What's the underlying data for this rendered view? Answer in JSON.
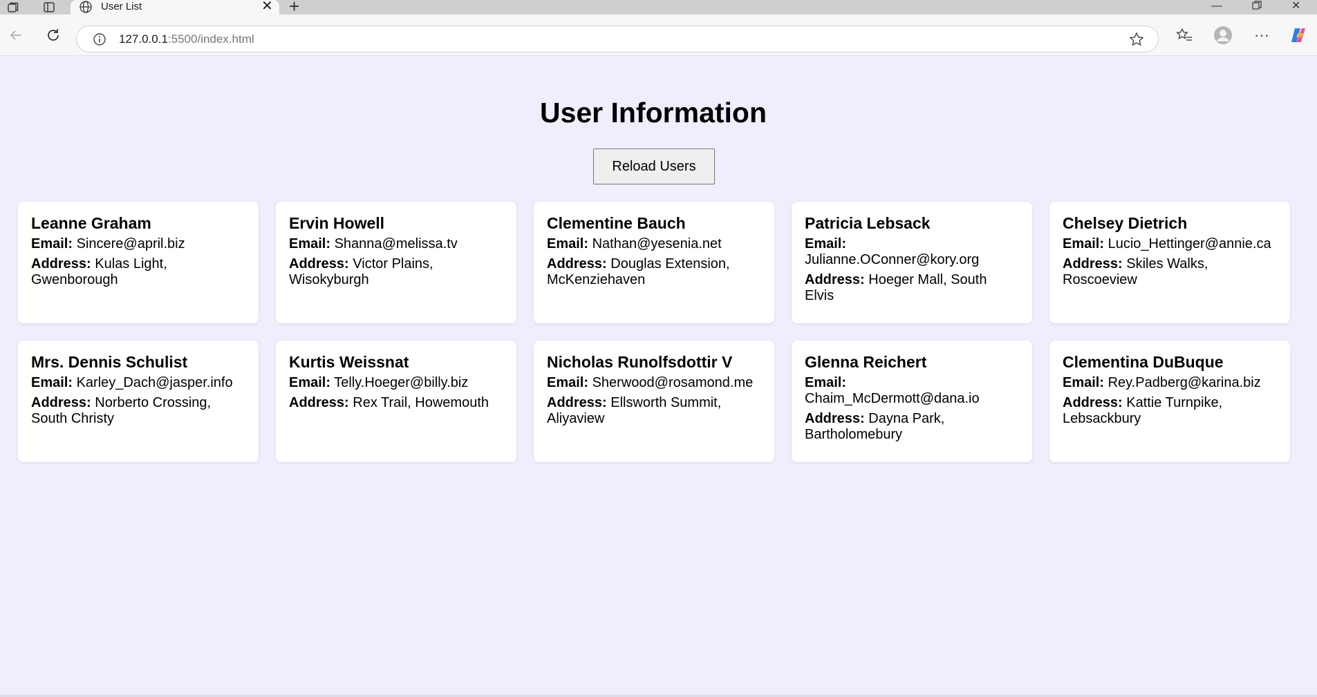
{
  "browser": {
    "tab_title": "User List",
    "url_host": "127.0.0.1",
    "url_rest": ":5500/index.html"
  },
  "page": {
    "heading": "User Information",
    "reload_label": "Reload Users",
    "email_label": "Email:",
    "address_label": "Address:"
  },
  "users": [
    {
      "name": "Leanne Graham",
      "email": "Sincere@april.biz",
      "address": "Kulas Light, Gwenborough"
    },
    {
      "name": "Ervin Howell",
      "email": "Shanna@melissa.tv",
      "address": "Victor Plains, Wisokyburgh"
    },
    {
      "name": "Clementine Bauch",
      "email": "Nathan@yesenia.net",
      "address": "Douglas Extension, McKenziehaven"
    },
    {
      "name": "Patricia Lebsack",
      "email": "Julianne.OConner@kory.org",
      "address": "Hoeger Mall, South Elvis"
    },
    {
      "name": "Chelsey Dietrich",
      "email": "Lucio_Hettinger@annie.ca",
      "address": "Skiles Walks, Roscoeview"
    },
    {
      "name": "Mrs. Dennis Schulist",
      "email": "Karley_Dach@jasper.info",
      "address": "Norberto Crossing, South Christy"
    },
    {
      "name": "Kurtis Weissnat",
      "email": "Telly.Hoeger@billy.biz",
      "address": "Rex Trail, Howemouth"
    },
    {
      "name": "Nicholas Runolfsdottir V",
      "email": "Sherwood@rosamond.me",
      "address": "Ellsworth Summit, Aliyaview"
    },
    {
      "name": "Glenna Reichert",
      "email": "Chaim_McDermott@dana.io",
      "address": "Dayna Park, Bartholomebury"
    },
    {
      "name": "Clementina DuBuque",
      "email": "Rey.Padberg@karina.biz",
      "address": "Kattie Turnpike, Lebsackbury"
    }
  ]
}
